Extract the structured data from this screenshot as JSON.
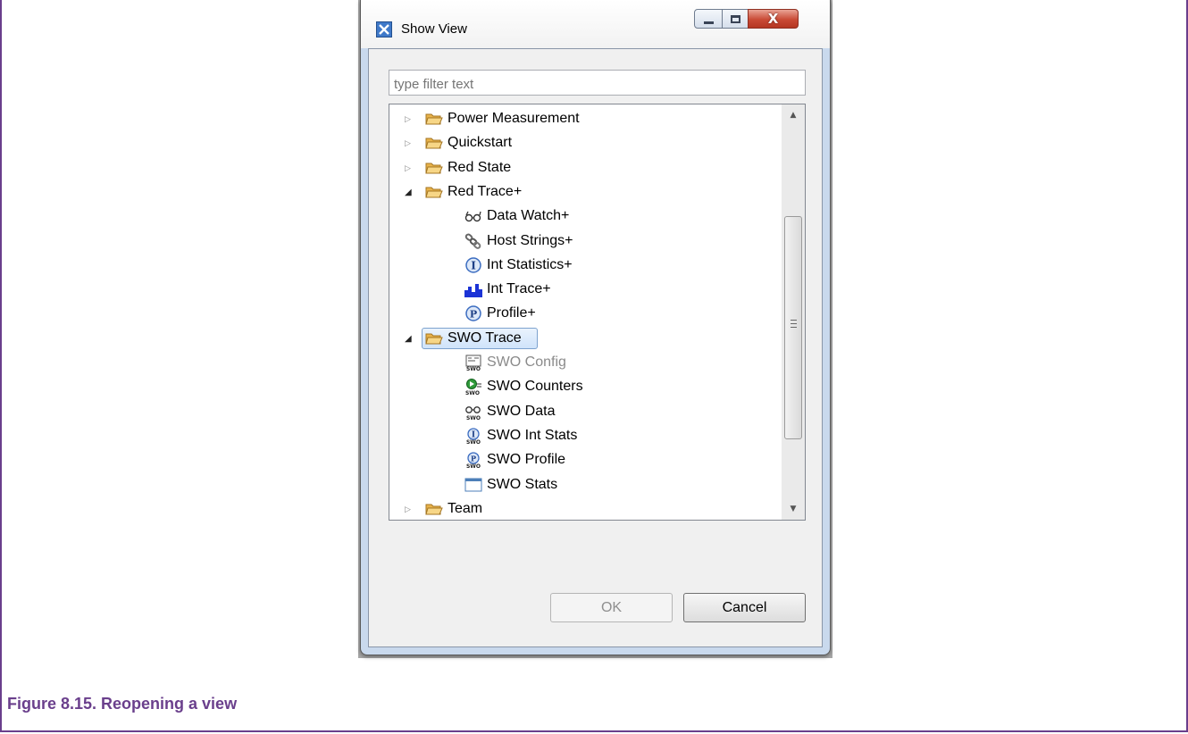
{
  "dialog": {
    "title": "Show View",
    "filter_placeholder": "type filter text",
    "ok_label": "OK",
    "cancel_label": "Cancel"
  },
  "tree": {
    "items": [
      {
        "label": "Power Measurement",
        "icon": "folder-icon",
        "expand": "collapsed",
        "level": 0
      },
      {
        "label": "Quickstart",
        "icon": "folder-icon",
        "expand": "collapsed",
        "level": 0
      },
      {
        "label": "Red State",
        "icon": "folder-icon",
        "expand": "collapsed",
        "level": 0
      },
      {
        "label": "Red Trace+",
        "icon": "folder-icon",
        "expand": "expanded",
        "level": 0
      },
      {
        "label": "Data Watch+",
        "icon": "glasses-icon",
        "level": 1
      },
      {
        "label": "Host Strings+",
        "icon": "chain-icon",
        "level": 1
      },
      {
        "label": "Int Statistics+",
        "icon": "info-circle-icon",
        "level": 1
      },
      {
        "label": "Int Trace+",
        "icon": "bar-chart-icon",
        "level": 1
      },
      {
        "label": "Profile+",
        "icon": "profile-circle-icon",
        "level": 1
      },
      {
        "label": "SWO Trace",
        "icon": "folder-icon",
        "expand": "expanded",
        "level": 0,
        "selected": true
      },
      {
        "label": "SWO Config",
        "icon": "swo-config-icon",
        "level": 1,
        "disabled": true
      },
      {
        "label": "SWO Counters",
        "icon": "swo-counters-icon",
        "level": 1
      },
      {
        "label": "SWO Data",
        "icon": "swo-data-icon",
        "level": 1
      },
      {
        "label": "SWO Int Stats",
        "icon": "swo-int-stats-icon",
        "level": 1
      },
      {
        "label": "SWO Profile",
        "icon": "swo-profile-icon",
        "level": 1
      },
      {
        "label": "SWO Stats",
        "icon": "window-icon",
        "level": 1
      },
      {
        "label": "Team",
        "icon": "folder-icon",
        "expand": "collapsed",
        "level": 0
      }
    ]
  },
  "caption": "Figure 8.15. Reopening a view",
  "colors": {
    "caption": "#6a3f8c",
    "folder": "#f2c46a",
    "selection": "#cfe3fa"
  }
}
